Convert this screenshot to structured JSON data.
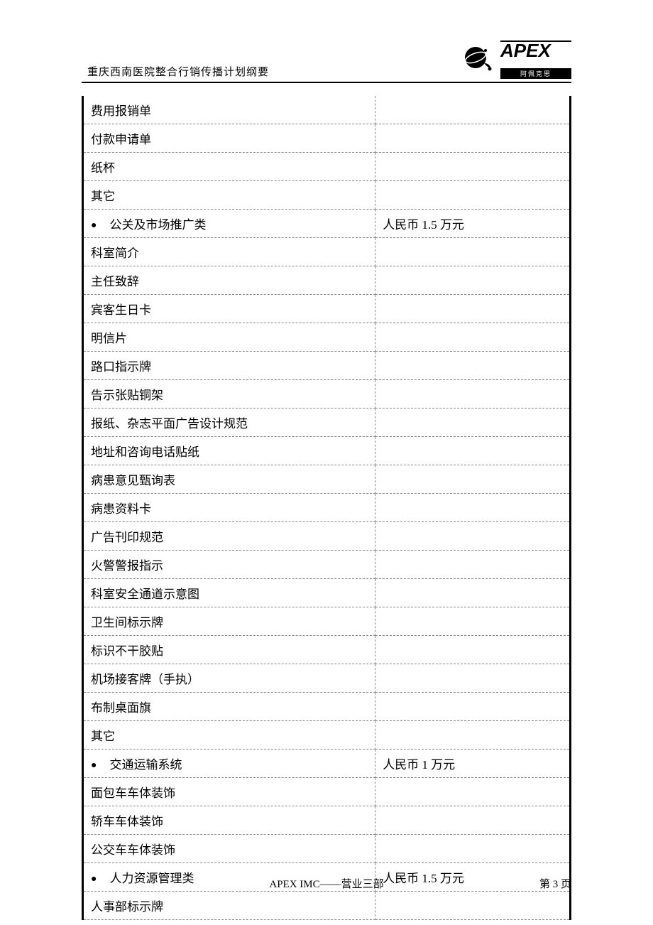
{
  "header": {
    "title": "重庆西南医院整合行销传播计划纲要",
    "logo_sub": "阿佩克思"
  },
  "rows": [
    {
      "c1": "费用报销单",
      "c2": "",
      "bullet": false
    },
    {
      "c1": "付款申请单",
      "c2": "",
      "bullet": false
    },
    {
      "c1": "纸杯",
      "c2": "",
      "bullet": false
    },
    {
      "c1": "其它",
      "c2": "",
      "bullet": false
    },
    {
      "c1": "公关及市场推广类",
      "c2": "人民币 1.5 万元",
      "bullet": true
    },
    {
      "c1": "科室简介",
      "c2": "",
      "bullet": false
    },
    {
      "c1": "主任致辞",
      "c2": "",
      "bullet": false
    },
    {
      "c1": "宾客生日卡",
      "c2": "",
      "bullet": false
    },
    {
      "c1": "明信片",
      "c2": "",
      "bullet": false
    },
    {
      "c1": "路口指示牌",
      "c2": "",
      "bullet": false
    },
    {
      "c1": "告示张贴铜架",
      "c2": "",
      "bullet": false
    },
    {
      "c1": "报纸、杂志平面广告设计规范",
      "c2": "",
      "bullet": false
    },
    {
      "c1": "地址和咨询电话贴纸",
      "c2": "",
      "bullet": false
    },
    {
      "c1": "病患意见甄询表",
      "c2": "",
      "bullet": false
    },
    {
      "c1": "病患资料卡",
      "c2": "",
      "bullet": false
    },
    {
      "c1": "广告刊印规范",
      "c2": "",
      "bullet": false
    },
    {
      "c1": "火警警报指示",
      "c2": "",
      "bullet": false
    },
    {
      "c1": "科室安全通道示意图",
      "c2": "",
      "bullet": false
    },
    {
      "c1": "卫生间标示牌",
      "c2": "",
      "bullet": false
    },
    {
      "c1": "标识不干胶贴",
      "c2": "",
      "bullet": false
    },
    {
      "c1": "机场接客牌（手执）",
      "c2": "",
      "bullet": false
    },
    {
      "c1": "布制桌面旗",
      "c2": "",
      "bullet": false
    },
    {
      "c1": "其它",
      "c2": "",
      "bullet": false
    },
    {
      "c1": "交通运输系统",
      "c2": "人民币 1 万元",
      "bullet": true
    },
    {
      "c1": "面包车车体装饰",
      "c2": "",
      "bullet": false
    },
    {
      "c1": "轿车车体装饰",
      "c2": "",
      "bullet": false
    },
    {
      "c1": "公交车车体装饰",
      "c2": "",
      "bullet": false
    },
    {
      "c1": "人力资源管理类",
      "c2": "人民币 1.5 万元",
      "bullet": true
    },
    {
      "c1": "人事部标示牌",
      "c2": "",
      "bullet": false
    }
  ],
  "footer": {
    "center": "APEX IMC——营业三部",
    "right": "第 3 页"
  }
}
